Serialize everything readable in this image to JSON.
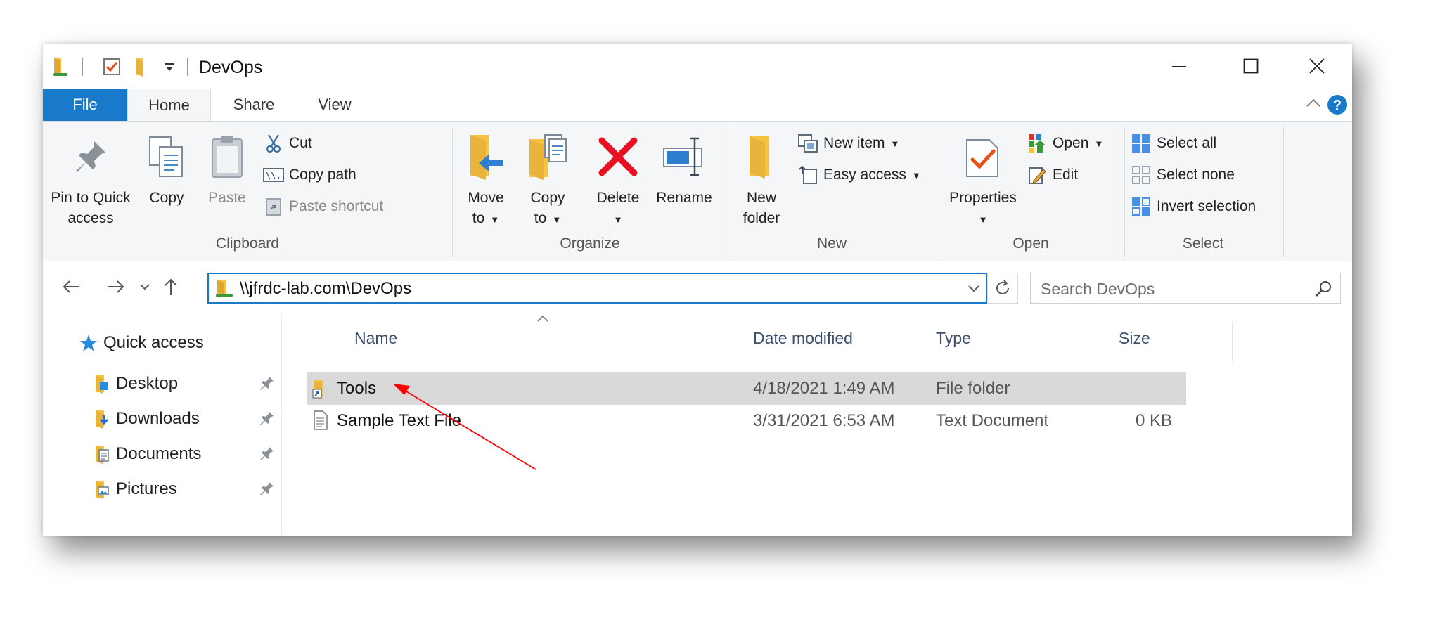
{
  "window": {
    "title": "DevOps"
  },
  "tabs": [
    {
      "label": "File"
    },
    {
      "label": "Home"
    },
    {
      "label": "Share"
    },
    {
      "label": "View"
    }
  ],
  "ribbon": {
    "clipboard": {
      "group_label": "Clipboard",
      "pin_line1": "Pin to Quick",
      "pin_line2": "access",
      "copy": "Copy",
      "paste": "Paste",
      "cut": "Cut",
      "copy_path": "Copy path",
      "paste_shortcut": "Paste shortcut"
    },
    "organize": {
      "group_label": "Organize",
      "move_line1": "Move",
      "move_line2": "to",
      "copy_line1": "Copy",
      "copy_line2": "to",
      "delete": "Delete",
      "rename": "Rename"
    },
    "new": {
      "group_label": "New",
      "new_folder_line1": "New",
      "new_folder_line2": "folder",
      "new_item": "New item",
      "easy_access": "Easy access"
    },
    "open": {
      "group_label": "Open",
      "properties": "Properties",
      "open": "Open",
      "edit": "Edit"
    },
    "select": {
      "group_label": "Select",
      "select_all": "Select all",
      "select_none": "Select none",
      "invert_selection": "Invert selection"
    }
  },
  "address": {
    "path": "\\\\jfrdc-lab.com\\DevOps",
    "search_placeholder": "Search DevOps"
  },
  "nav_pane": {
    "quick_access": "Quick access",
    "items": [
      {
        "label": "Desktop"
      },
      {
        "label": "Downloads"
      },
      {
        "label": "Documents"
      },
      {
        "label": "Pictures"
      }
    ]
  },
  "file_list": {
    "columns": [
      "Name",
      "Date modified",
      "Type",
      "Size"
    ],
    "rows": [
      {
        "name": "Tools",
        "date": "4/18/2021 1:49 AM",
        "type": "File folder",
        "size": "",
        "selected": true
      },
      {
        "name": "Sample Text File",
        "date": "3/31/2021 6:53 AM",
        "type": "Text Document",
        "size": "0 KB",
        "selected": false
      }
    ]
  },
  "colors": {
    "accent": "#1979ca",
    "ribbon_bg": "#f5f6f7",
    "selected_row": "#d9d9d9",
    "folder_yellow": "#f5c542",
    "delete_red": "#e81123",
    "annotation_arrow": "#ff0000"
  }
}
